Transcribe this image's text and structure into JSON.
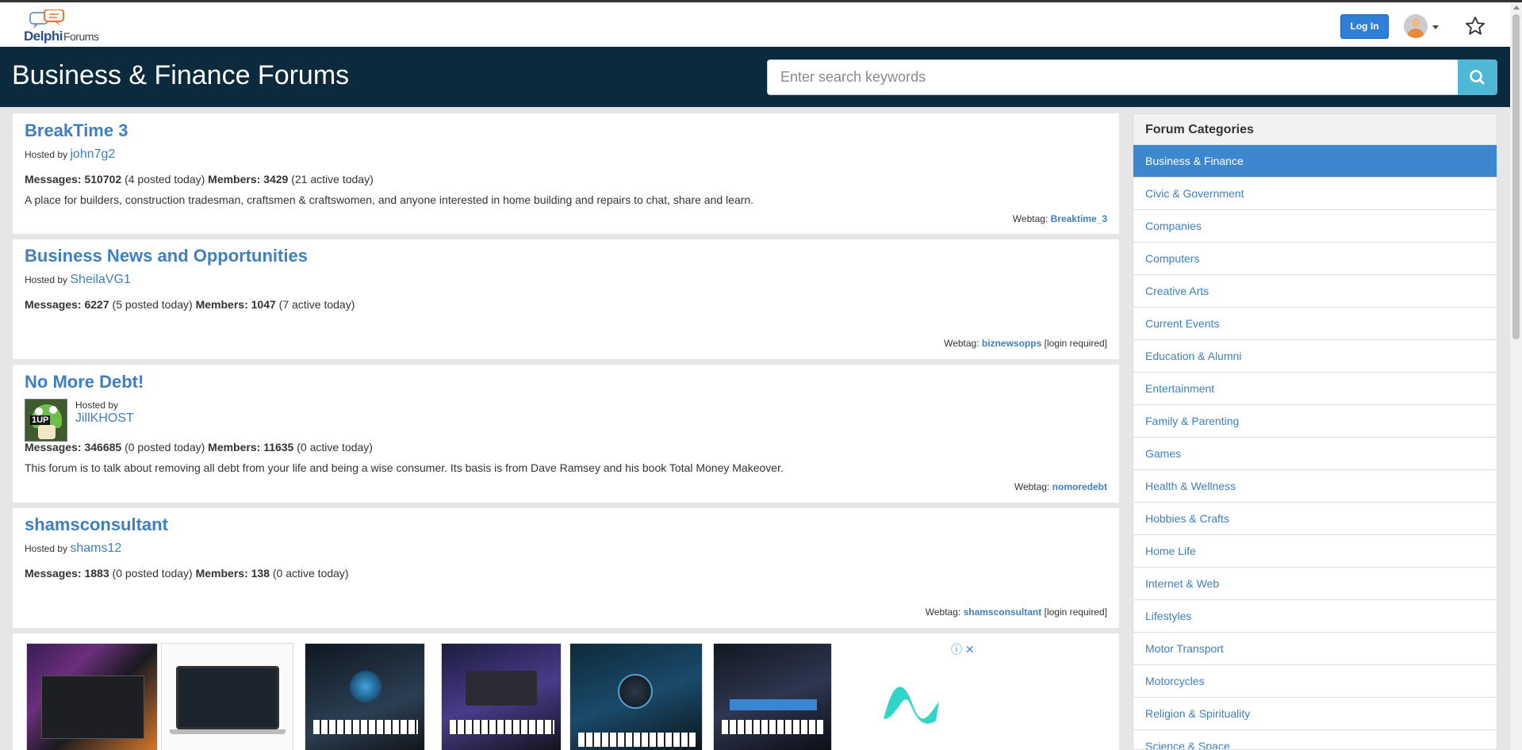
{
  "logo": {
    "brand": "Delphi",
    "suffix": "Forums"
  },
  "topbar": {
    "login_label": "Log In"
  },
  "header": {
    "title": "Business & Finance Forums",
    "search_placeholder": "Enter search keywords"
  },
  "forums": [
    {
      "title": "BreakTime 3",
      "hosted_by_label": "Hosted by",
      "host": "john7g2",
      "messages_label": "Messages:",
      "messages": "510702",
      "messages_today": "(4 posted today)",
      "members_label": "Members:",
      "members": "3429",
      "members_today": "(21 active today)",
      "description": "A place for builders, construction tradesman, craftsmen & craftswomen, and anyone interested in home building and repairs to chat, share and learn.",
      "webtag_label": "Webtag:",
      "webtag": "Breaktime_3",
      "login_note": ""
    },
    {
      "title": "Business News and Opportunities",
      "hosted_by_label": "Hosted by",
      "host": "SheilaVG1",
      "messages_label": "Messages:",
      "messages": "6227",
      "messages_today": "(5 posted today)",
      "members_label": "Members:",
      "members": "1047",
      "members_today": "(7 active today)",
      "description": "",
      "webtag_label": "Webtag:",
      "webtag": "biznewsopps",
      "login_note": "[login required]"
    },
    {
      "title": "No More Debt!",
      "hosted_by_label": "Hosted by",
      "host": "JillKHOST",
      "avatar_text": "1UP",
      "messages_label": "Messages:",
      "messages": "346685",
      "messages_today": "(0 posted today)",
      "members_label": "Members:",
      "members": "11635",
      "members_today": "(0 active today)",
      "description": "This forum is to talk about removing all debt from your life and being a wise consumer. Its basis is from Dave Ramsey and his book Total Money Makeover.",
      "webtag_label": "Webtag:",
      "webtag": "nomoredebt",
      "login_note": ""
    },
    {
      "title": "shamsconsultant",
      "hosted_by_label": "Hosted by",
      "host": "shams12",
      "messages_label": "Messages:",
      "messages": "1883",
      "messages_today": "(0 posted today)",
      "members_label": "Members:",
      "members": "138",
      "members_today": "(0 active today)",
      "description": "",
      "webtag_label": "Webtag:",
      "webtag": "shamsconsultant",
      "login_note": "[login required]"
    }
  ],
  "ad": {
    "close_label": "ⓘ ✕"
  },
  "sidebar": {
    "title": "Forum Categories",
    "items": [
      "Business & Finance",
      "Civic & Government",
      "Companies",
      "Computers",
      "Creative Arts",
      "Current Events",
      "Education & Alumni",
      "Entertainment",
      "Family & Parenting",
      "Games",
      "Health & Wellness",
      "Hobbies & Crafts",
      "Home Life",
      "Internet & Web",
      "Lifestyles",
      "Motor Transport",
      "Motorcycles",
      "Religion & Spirituality",
      "Science & Space"
    ],
    "active": "Business & Finance"
  },
  "colors": {
    "link": "#3f7fbf",
    "header_bg": "#0c2a3e",
    "active_category": "#3d87cf",
    "search_button": "#4fb8d6",
    "login_button": "#2f7fd6"
  }
}
